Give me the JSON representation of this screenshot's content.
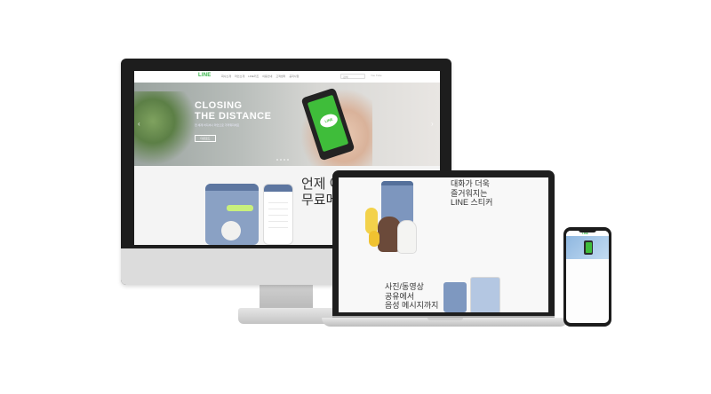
{
  "desktop": {
    "logo": "LINE",
    "menu": [
      "회사소개",
      "라인소개",
      "LINE키즈",
      "이용안내",
      "고객센터",
      "공지사항"
    ],
    "search_placeholder": "검색",
    "youtube_label": "You Tube",
    "hero": {
      "title_line1": "CLOSING",
      "title_line2": "THE DISTANCE",
      "subtitle": "전 세계 어디서나 라인으로 가까워지세요",
      "button_label": "다운로드"
    },
    "section2": {
      "title_line1": "언제 어",
      "title_line2": "무료메"
    }
  },
  "laptop": {
    "section1": {
      "title_line1": "대화가 더욱",
      "title_line2": "즐거워지는",
      "title_line3": "LINE 스티커"
    },
    "section2": {
      "title_line1": "사진/동영상",
      "title_line2": "공유에서",
      "title_line3": "음성 메시지까지"
    }
  },
  "phone": {
    "logo": "LINE"
  },
  "colors": {
    "brand_green": "#35b347",
    "app_blue": "#7d96be"
  }
}
